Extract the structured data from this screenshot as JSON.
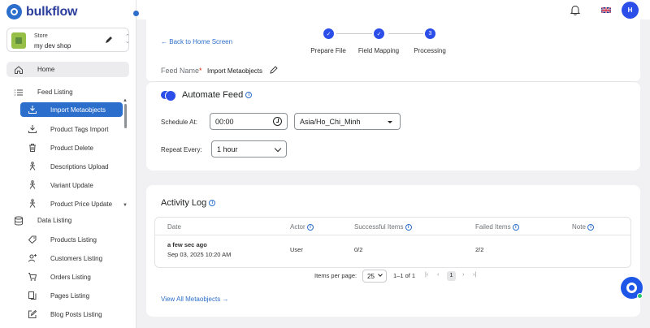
{
  "brand": {
    "name": "bulkflow"
  },
  "store": {
    "label": "Store",
    "name": "my dev shop"
  },
  "sidebar": {
    "home": "Home",
    "feed_listing": "Feed Listing",
    "feed_items": [
      {
        "label": "Import Metaobjects",
        "icon": "download-icon"
      },
      {
        "label": "Product Tags Import",
        "icon": "download-icon"
      },
      {
        "label": "Product Delete",
        "icon": "trash-icon"
      },
      {
        "label": "Descriptions Upload",
        "icon": "stickman-icon"
      },
      {
        "label": "Variant Update",
        "icon": "stickman-icon"
      },
      {
        "label": "Product Price Update",
        "icon": "stickman-icon"
      }
    ],
    "data_listing": "Data Listing",
    "data_items": [
      {
        "label": "Products Listing",
        "icon": "tag-icon"
      },
      {
        "label": "Customers Listing",
        "icon": "person-add-icon"
      },
      {
        "label": "Orders Listing",
        "icon": "cart-icon"
      },
      {
        "label": "Pages Listing",
        "icon": "pages-icon"
      },
      {
        "label": "Blog Posts Listing",
        "icon": "edit-icon"
      }
    ]
  },
  "header": {
    "avatar_initial": "H"
  },
  "feed": {
    "back_label": "Back to Home Screen",
    "steps": [
      {
        "label": "Prepare File",
        "mark": "✓"
      },
      {
        "label": "Field Mapping",
        "mark": "✓"
      },
      {
        "label": "Processing",
        "mark": "3"
      }
    ],
    "name_label": "Feed Name",
    "name_value": "Import Metaobjects"
  },
  "automate": {
    "title": "Automate Feed",
    "enabled": true,
    "schedule_label": "Schedule At:",
    "schedule_time": "00:00",
    "timezone": "Asia/Ho_Chi_Minh",
    "repeat_label": "Repeat Every:",
    "repeat_value": "1 hour"
  },
  "activity": {
    "title": "Activity Log",
    "columns": {
      "date": "Date",
      "actor": "Actor",
      "success": "Successful Items",
      "failed": "Failed Items",
      "note": "Note"
    },
    "rows": [
      {
        "relative": "a few sec ago",
        "date": "Sep 03, 2025 10:20 AM",
        "actor": "User",
        "success": "0/2",
        "failed": "2/2",
        "note": ""
      }
    ],
    "items_per_page_label": "Items per page:",
    "items_per_page": "25",
    "range": "1–1 of 1",
    "current_page": "1",
    "view_all": "View All Metaobjects"
  },
  "colors": {
    "primary": "#2c6ecb",
    "accent": "#2c4ee8"
  }
}
